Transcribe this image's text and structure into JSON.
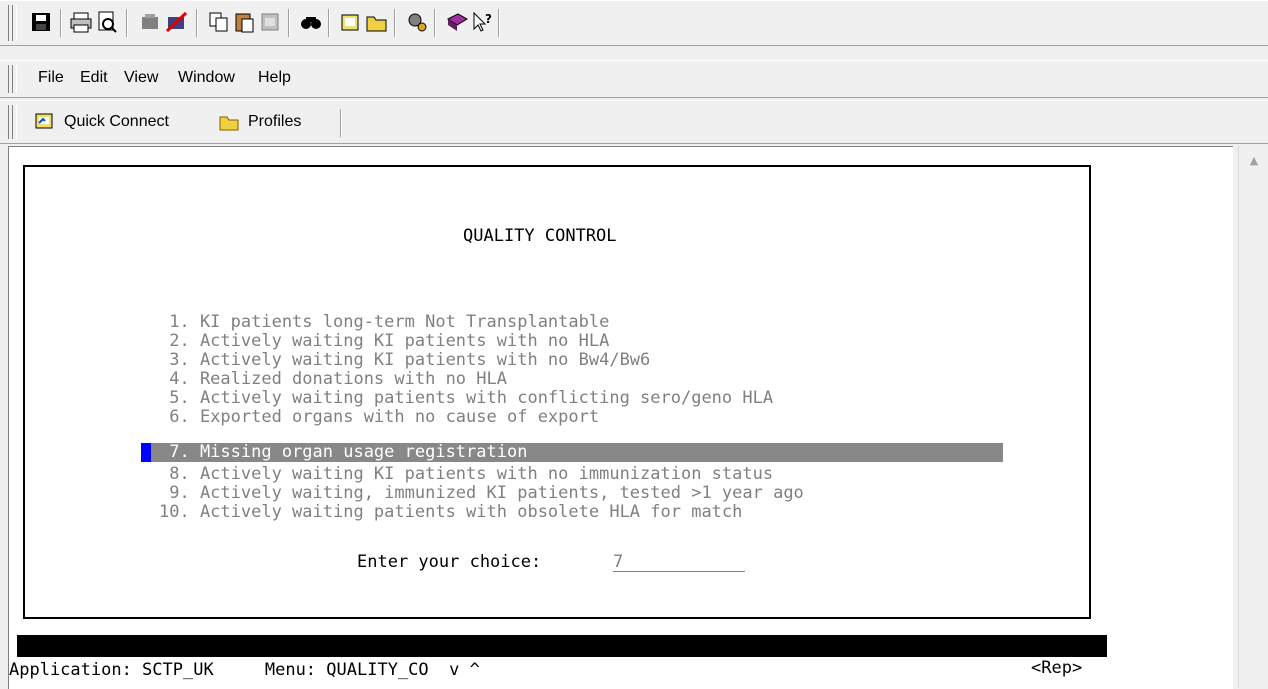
{
  "toolbar": {
    "icons": [
      "save-icon",
      "print-icon",
      "print-preview-icon",
      "connect-icon",
      "disconnect-icon",
      "copy-icon",
      "paste-icon",
      "paste-disabled-icon",
      "find-icon",
      "open-session-icon",
      "folder-icon",
      "settings-icon",
      "help-book-icon",
      "context-help-icon"
    ]
  },
  "menu": {
    "file": "File",
    "edit": "Edit",
    "view": "View",
    "window": "Window",
    "help": "Help"
  },
  "connbar": {
    "quick_connect": "Quick Connect",
    "profiles": "Profiles"
  },
  "screen": {
    "title": "QUALITY CONTROL",
    "options": [
      " 1. KI patients long-term Not Transplantable",
      " 2. Actively waiting KI patients with no HLA",
      " 3. Actively waiting KI patients with no Bw4/Bw6",
      " 4. Realized donations with no HLA",
      " 5. Actively waiting patients with conflicting sero/geno HLA",
      " 6. Exported organs with no cause of export",
      " 7. Missing organ usage registration",
      " 8. Actively waiting KI patients with no immunization status",
      " 9. Actively waiting, immunized KI patients, tested >1 year ago",
      "10. Actively waiting patients with obsolete HLA for match"
    ],
    "selected_option_index": 6,
    "prompt": "Enter your choice:",
    "choice_value": "7"
  },
  "status": {
    "line": "Application: SCTP_UK     Menu: QUALITY_CO  v ^",
    "rep": "<Rep>"
  },
  "colors": {
    "highlight": "#888888",
    "cursor": "#0000ff",
    "dim_text": "#808080"
  }
}
